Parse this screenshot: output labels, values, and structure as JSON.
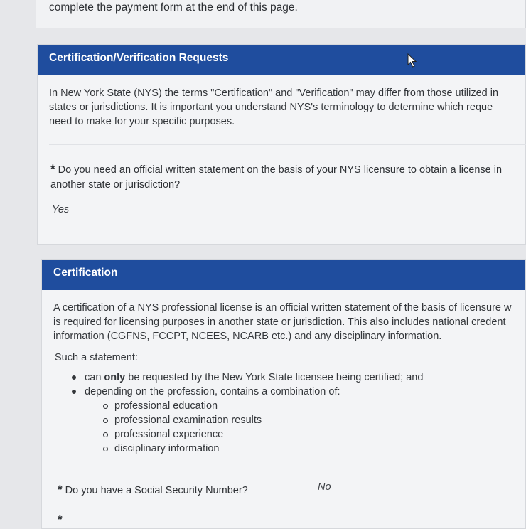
{
  "intro": {
    "text": "complete the payment form at the end of this page."
  },
  "verification_section": {
    "title": "Certification/Verification Requests",
    "paragraph_lines": [
      "In New York State (NYS) the terms \"Certification\" and \"Verification\" may differ from those utilized in",
      "states or jurisdictions. It is important you understand NYS's terminology to determine which reque",
      "need to make for your specific purposes."
    ],
    "question": {
      "required_marker": "*",
      "lines": [
        "Do you need an official written statement on the basis of your NYS licensure to obtain a license in",
        "another state or jurisdiction?"
      ],
      "answer": "Yes"
    }
  },
  "certification_section": {
    "title": "Certification",
    "paragraph_lines": [
      "A certification of a NYS professional license is an official written statement of the basis of licensure w",
      "is required for licensing purposes in another state or jurisdiction. This also includes national credent",
      "information (CGFNS, FCCPT, NCEES, NCARB etc.) and any disciplinary information."
    ],
    "such_statement": "Such a statement:",
    "bullets": [
      {
        "pre": "can ",
        "bold": "only",
        "post": " be requested by the New York State licensee being certified; and"
      },
      {
        "pre": "depending on the profession, contains a combination of:",
        "bold": "",
        "post": ""
      }
    ],
    "sub_bullets": [
      "professional education",
      "professional examination results",
      "professional experience",
      "disciplinary information"
    ],
    "ssn_question": {
      "required_marker": "*",
      "label": "Do you have a Social Security Number?",
      "answer": "No"
    },
    "next_required_marker": "*"
  },
  "icons": {
    "cursor": "mouse-pointer-icon"
  },
  "colors": {
    "header_bg": "#1f4d9e",
    "page_bg": "#e6e7ea",
    "panel_bg": "#f3f4f6"
  }
}
